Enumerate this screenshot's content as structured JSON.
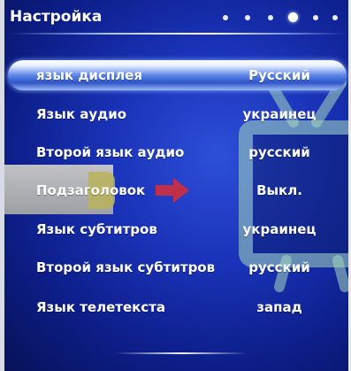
{
  "header": {
    "title": "Настройка",
    "page_dots": {
      "count": 6,
      "active_index": 4
    }
  },
  "menu": {
    "selected_index": 0,
    "items": [
      {
        "label": "язык дисплея",
        "value": "Русский"
      },
      {
        "label": "Язык аудио",
        "value": "украинец"
      },
      {
        "label": "Второй язык аудио",
        "value": "русский"
      },
      {
        "label": "Подзаголовок",
        "value": "Выкл."
      },
      {
        "label": "Язык субтитров",
        "value": "украинец"
      },
      {
        "label": "Второй язык субтитров",
        "value": "русский"
      },
      {
        "label": "Язык телетекста",
        "value": "запад"
      }
    ]
  },
  "colors": {
    "background": "#1a33b8",
    "highlight": "#5d86e8",
    "text": "#ffffff",
    "arrow": "#c0304a",
    "tv_outline": "#9fd4b6"
  },
  "icons": [
    "tv-icon",
    "arrow-right-icon",
    "label-tag-icon"
  ]
}
